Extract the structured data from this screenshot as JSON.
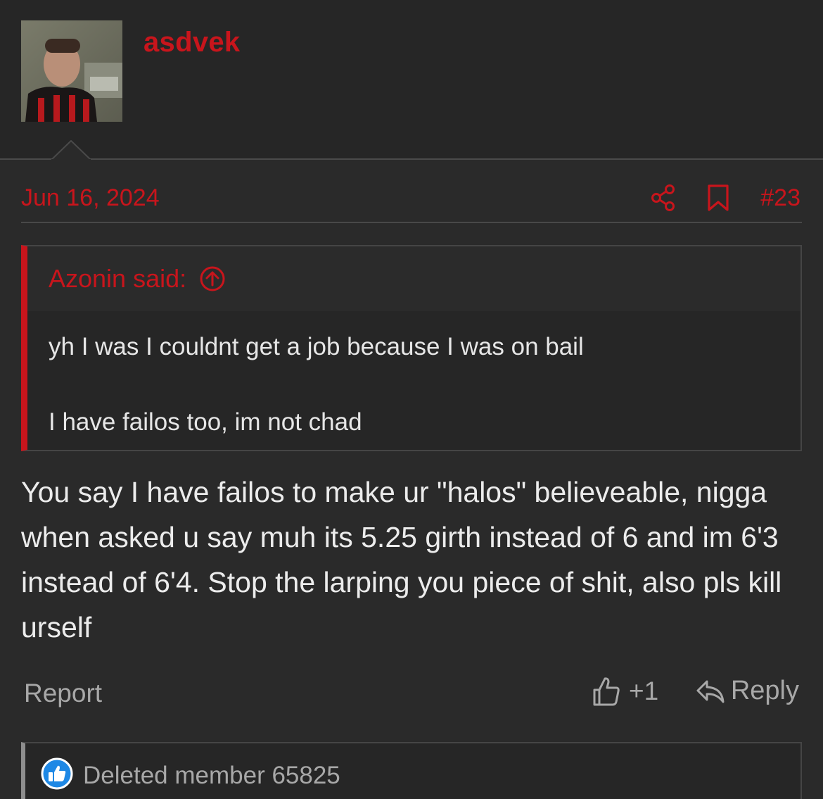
{
  "user": {
    "username": "asdvek",
    "avatar_icon": "avatar-photo"
  },
  "post": {
    "date": "Jun 16, 2024",
    "number": "#23",
    "share_icon": "share-icon",
    "bookmark_icon": "bookmark-icon"
  },
  "quote": {
    "author": "Azonin said:",
    "jump_icon": "arrow-up-circle-icon",
    "lines": [
      "yh I was I couldnt get a job because I was on bail",
      "I have failos too, im not chad"
    ]
  },
  "message": {
    "text": "You say I have failos to make ur \"halos\" believeable, nigga when asked u say muh its 5.25 girth instead of 6 and im 6'3 instead of 6'4. Stop the larping you piece of shit, also pls kill urself"
  },
  "actions": {
    "report_label": "Report",
    "like_count": "+1",
    "like_icon": "thumbs-up-icon",
    "reply_label": "Reply",
    "reply_icon": "reply-arrow-icon"
  },
  "reactions": {
    "icon": "like-reaction-icon",
    "member": "Deleted member 65825"
  },
  "colors": {
    "accent": "#c8151c",
    "background": "#2a2a2a",
    "text": "#ececec",
    "muted": "#a8a8a8"
  }
}
